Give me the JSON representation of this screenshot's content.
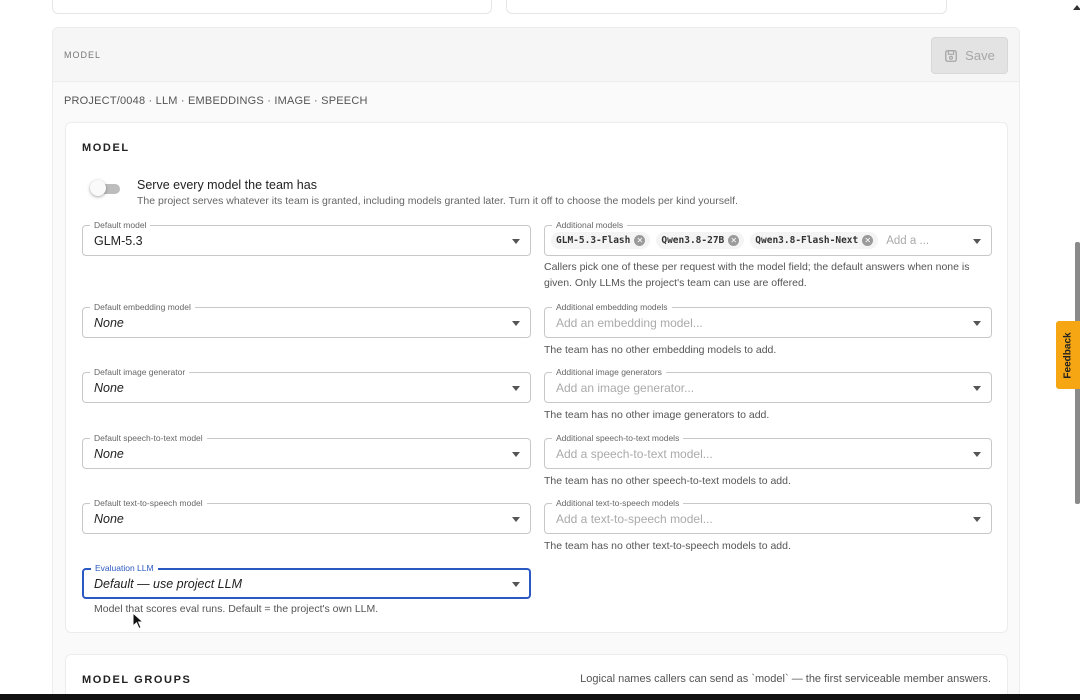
{
  "header": {
    "section_label": "MODEL",
    "save_label": "Save"
  },
  "breadcrumb": "PROJECT/0048 · LLM · EMBEDDINGS · IMAGE · SPEECH",
  "model_card": {
    "title": "MODEL",
    "serve_all": {
      "label": "Serve every model the team has",
      "help": "The project serves whatever its team is granted, including models granted later. Turn it off to choose the models per kind yourself.",
      "enabled": false
    },
    "default_model": {
      "legend": "Default model",
      "value": "GLM-5.3"
    },
    "additional_models": {
      "legend": "Additional models",
      "chips": [
        "GLM-5.3-Flash",
        "Qwen3.8-27B",
        "Qwen3.8-Flash-Next"
      ],
      "placeholder": "Add a ...",
      "help": "Callers pick one of these per request with the model field; the default answers when none is given. Only LLMs the project's team can use are offered."
    },
    "default_embedding": {
      "legend": "Default embedding model",
      "value": "None"
    },
    "additional_embedding": {
      "legend": "Additional embedding models",
      "placeholder": "Add an embedding model...",
      "help": "The team has no other embedding models to add."
    },
    "default_image": {
      "legend": "Default image generator",
      "value": "None"
    },
    "additional_image": {
      "legend": "Additional image generators",
      "placeholder": "Add an image generator...",
      "help": "The team has no other image generators to add."
    },
    "default_stt": {
      "legend": "Default speech-to-text model",
      "value": "None"
    },
    "additional_stt": {
      "legend": "Additional speech-to-text models",
      "placeholder": "Add a speech-to-text model...",
      "help": "The team has no other speech-to-text models to add."
    },
    "default_tts": {
      "legend": "Default text-to-speech model",
      "value": "None"
    },
    "additional_tts": {
      "legend": "Additional text-to-speech models",
      "placeholder": "Add a text-to-speech model...",
      "help": "The team has no other text-to-speech models to add."
    },
    "evaluation_llm": {
      "legend": "Evaluation LLM",
      "value": "Default — use project LLM",
      "help": "Model that scores eval runs. Default = the project's own LLM."
    }
  },
  "model_groups": {
    "title": "MODEL GROUPS",
    "help": "Logical names callers can send as `model` — the first serviceable member answers."
  },
  "feedback_label": "Feedback",
  "colors": {
    "accent": "#2b59c3",
    "feedback": "#f5a612"
  }
}
